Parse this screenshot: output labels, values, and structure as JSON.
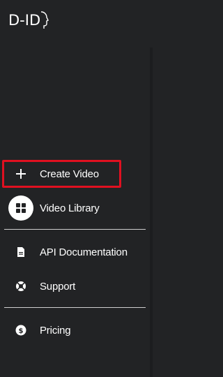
{
  "brand": {
    "logo_text": "D-ID"
  },
  "nav": {
    "primary": [
      {
        "label": "Create Video",
        "icon": "plus-icon",
        "highlighted": true
      },
      {
        "label": "Video Library",
        "icon": "grid-icon"
      }
    ],
    "secondary": [
      {
        "label": "API Documentation",
        "icon": "document-icon"
      },
      {
        "label": "Support",
        "icon": "lifebuoy-icon"
      }
    ],
    "tertiary": [
      {
        "label": "Pricing",
        "icon": "dollar-coin-icon"
      }
    ]
  },
  "colors": {
    "sidebar_bg": "#222325",
    "text": "#ffffff",
    "highlight_border": "#e01020",
    "divider": "#cfcfcf"
  }
}
